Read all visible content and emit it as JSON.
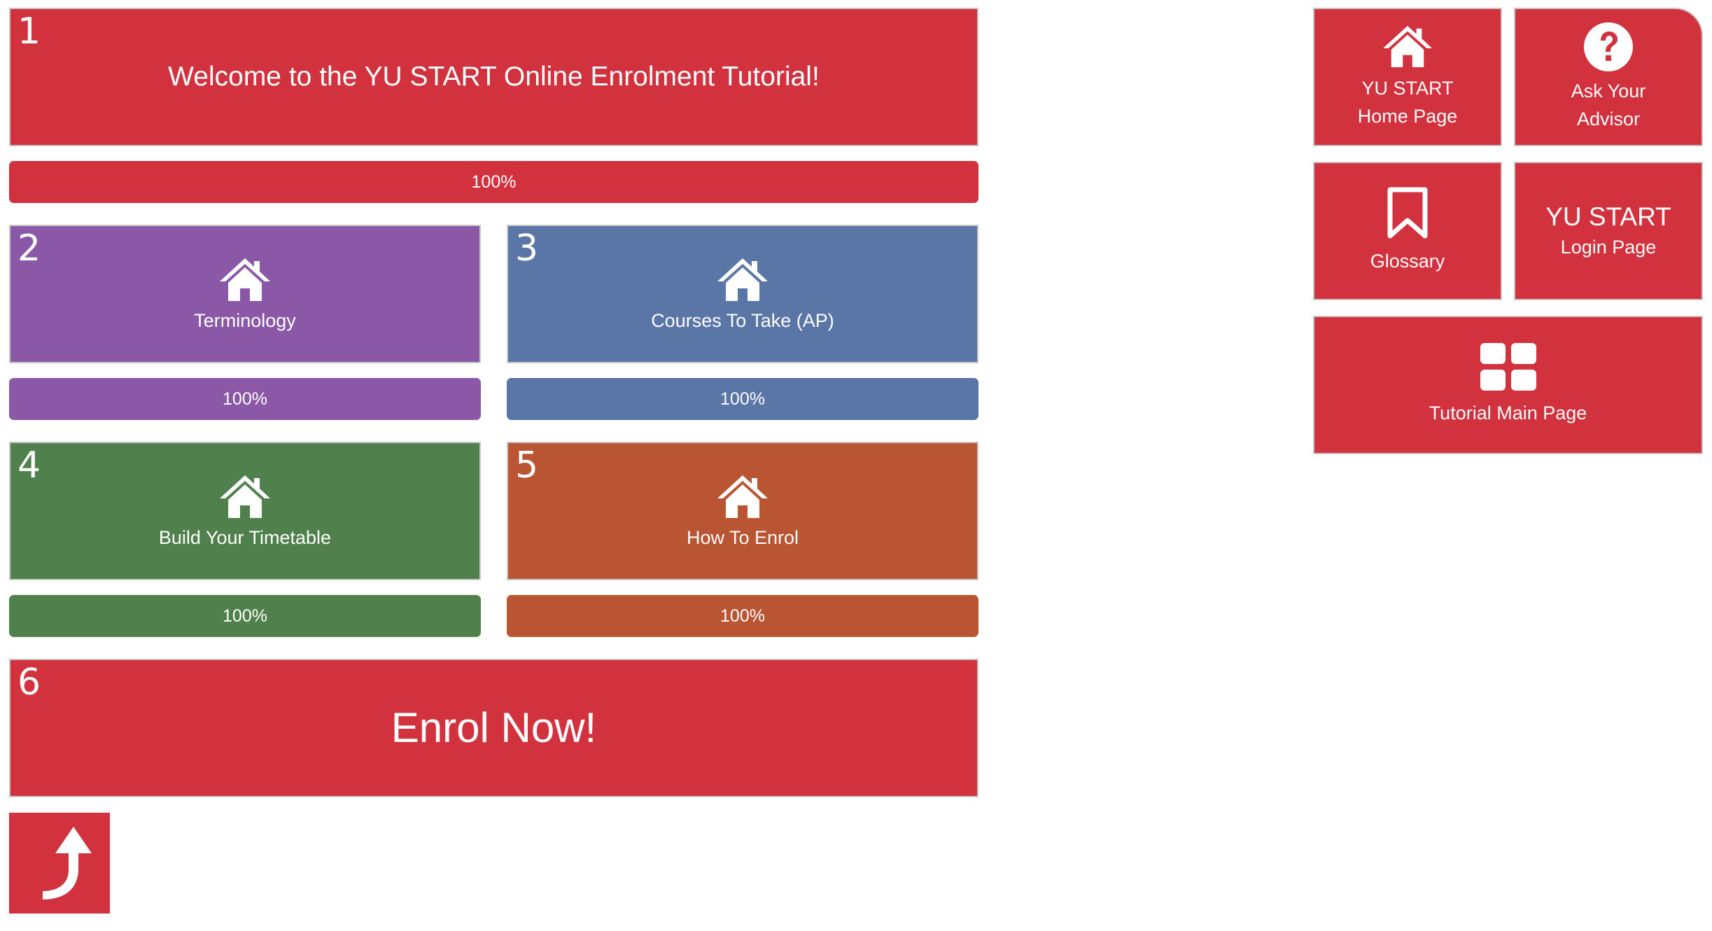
{
  "colors": {
    "red": "#d1323d",
    "red_bar": "#d1323d",
    "purple": "#8a58a6",
    "blue": "#5a76a6",
    "green": "#50804c",
    "orange": "#b95532"
  },
  "steps": [
    {
      "number": "1",
      "label": "Welcome to the YU START Online Enrolment Tutorial!",
      "progress_text": "100%",
      "progress": 100
    },
    {
      "number": "2",
      "label": "Terminology",
      "icon": "home-icon",
      "progress_text": "100%",
      "progress": 100
    },
    {
      "number": "3",
      "label": "Courses To Take (AP)",
      "icon": "home-icon",
      "progress_text": "100%",
      "progress": 100
    },
    {
      "number": "4",
      "label": "Build Your Timetable",
      "icon": "home-icon",
      "progress_text": "100%",
      "progress": 100
    },
    {
      "number": "5",
      "label": "How To Enrol",
      "icon": "home-icon",
      "progress_text": "100%",
      "progress": 100
    },
    {
      "number": "6",
      "label": "Enrol Now!"
    }
  ],
  "back_button": {
    "icon": "curved-arrow-up-icon"
  },
  "sidebar": {
    "home": {
      "line1": "YU START",
      "line2": "Home Page",
      "icon": "home-icon"
    },
    "advisor": {
      "line1": "Ask Your",
      "line2": "Advisor",
      "icon": "question-circle-icon"
    },
    "glossary": {
      "label": "Glossary",
      "icon": "bookmark-icon"
    },
    "login": {
      "line1": "YU START",
      "line2": "Login Page"
    },
    "tutorial_main": {
      "label": "Tutorial Main Page",
      "icon": "grid-icon"
    }
  }
}
